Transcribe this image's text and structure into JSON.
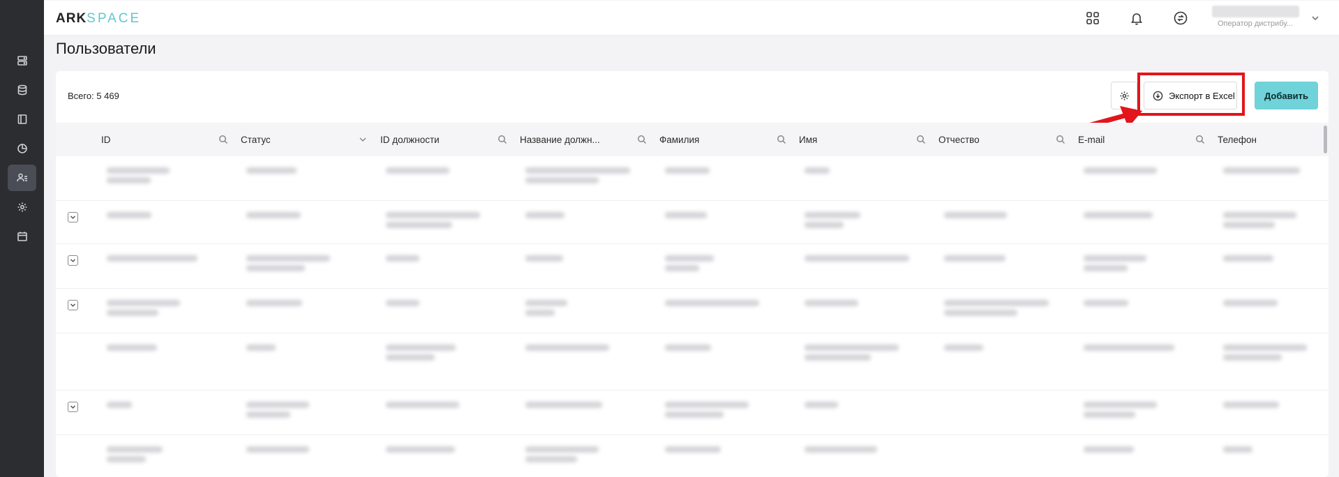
{
  "brand": {
    "part1": "ARK",
    "part2": "SPACE"
  },
  "user": {
    "role": "Оператор дистрибу..."
  },
  "page": {
    "title": "Пользователи"
  },
  "toolbar": {
    "total_label": "Всего: 5 469",
    "export_label": "Экспорт в Excel",
    "add_label": "Добавить"
  },
  "table": {
    "columns": [
      {
        "label": "ID",
        "icon": "search-icon"
      },
      {
        "label": "Статус",
        "icon": "chevron-down-icon"
      },
      {
        "label": "ID должности",
        "icon": "search-icon"
      },
      {
        "label": "Название должн...",
        "icon": "search-icon"
      },
      {
        "label": "Фамилия",
        "icon": "search-icon"
      },
      {
        "label": "Имя",
        "icon": "search-icon"
      },
      {
        "label": "Отчество",
        "icon": "search-icon"
      },
      {
        "label": "E-mail",
        "icon": "search-icon"
      },
      {
        "label": "Телефон",
        "icon": ""
      }
    ]
  },
  "annotation": {
    "highlight_color": "#e3141b"
  },
  "colors": {
    "accent": "#6fd3d9",
    "sidebar": "#2b2d31"
  }
}
